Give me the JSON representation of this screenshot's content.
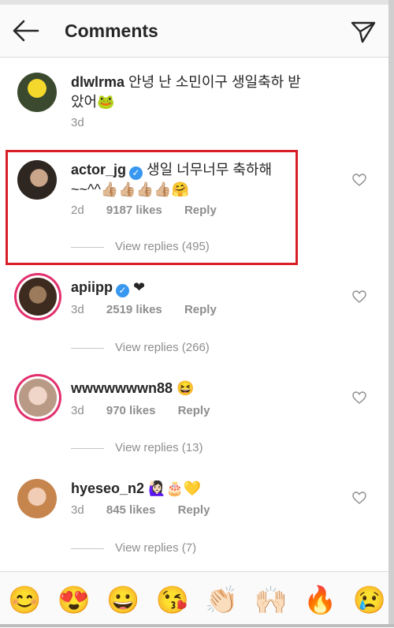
{
  "header": {
    "title": "Comments"
  },
  "comments": [
    {
      "username": "dlwlrma",
      "text": "안녕 난 소민이구 생일축하 받았어🐸",
      "time": "3d"
    },
    {
      "username": "actor_jg",
      "verified": true,
      "text": "생일 너무너무 축하해~~^^👍🏼👍🏼👍🏼👍🏼🤗",
      "time": "2d",
      "likes": "9187 likes",
      "reply": "Reply",
      "view_replies": "View replies (495)"
    },
    {
      "username": "apiipp",
      "verified": true,
      "text": "❤",
      "time": "3d",
      "likes": "2519 likes",
      "reply": "Reply",
      "view_replies": "View replies (266)"
    },
    {
      "username": "wwwwwwwn88",
      "text": "😆",
      "time": "3d",
      "likes": "970 likes",
      "reply": "Reply",
      "view_replies": "View replies (13)"
    },
    {
      "username": "hyeseo_n2",
      "text": "🙋🏻‍♀️🎂💛",
      "time": "3d",
      "likes": "845 likes",
      "reply": "Reply",
      "view_replies": "View replies (7)"
    }
  ],
  "emoji_bar": [
    "😊",
    "😍",
    "😀",
    "😘",
    "👏🏻",
    "🙌🏻",
    "🔥",
    "😢"
  ],
  "colors": {
    "highlight": "#d91e25",
    "verified": "#3897f0",
    "meta": "#8e8e8e"
  }
}
